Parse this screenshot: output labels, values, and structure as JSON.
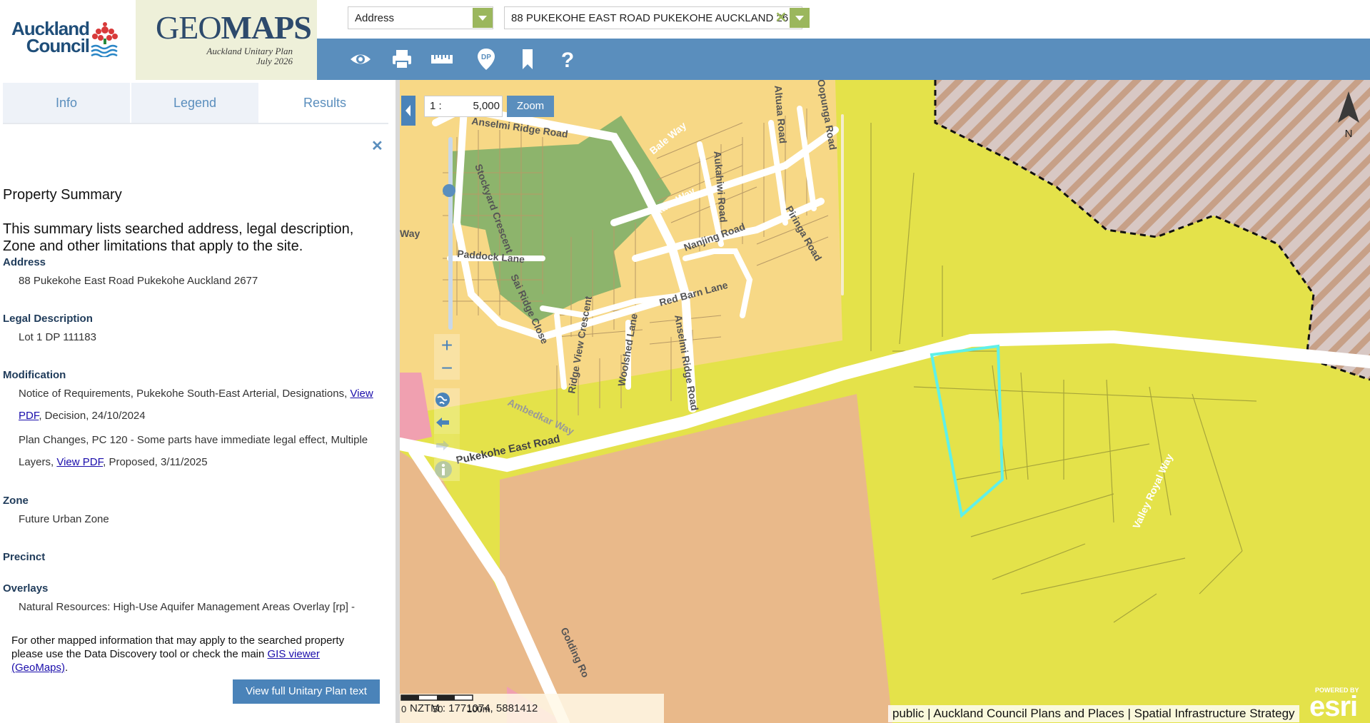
{
  "header": {
    "logo_line1": "Auckland",
    "logo_line2": "Council",
    "app_title_light": "GEO",
    "app_title_bold": "MAPS",
    "app_subtitle_1": "Auckland Unitary Plan",
    "app_subtitle_2": "July 2026"
  },
  "search": {
    "type_value": "Address",
    "query_value": "88 PUKEKOHE EAST ROAD PUKEKOHE AUCKLAND 26",
    "clear_glyph": "✕"
  },
  "toolbar": {
    "icons": [
      "eye-icon",
      "print-icon",
      "ruler-icon",
      "dp-pin-icon",
      "bookmark-icon",
      "help-icon"
    ],
    "dp_label": "DP",
    "help_glyph": "?"
  },
  "panel": {
    "tabs": [
      "Info",
      "Legend",
      "Results"
    ],
    "active_tab": "Results",
    "close_glyph": "✕",
    "summary_title": "Property Summary",
    "summary_desc": "This summary lists searched address, legal description, Zone and other limitations that apply to the site.",
    "address_h": "Address",
    "address_v": "88 Pukekohe East Road Pukekohe Auckland 2677",
    "legal_h": "Legal Description",
    "legal_v": "Lot 1 DP 111183",
    "mod_h": "Modification",
    "mod1_pre": "Notice of Requirements, Pukekohe South-East Arterial, Designations, ",
    "mod1_link": "View PDF",
    "mod1_post": ", Decision, 24/10/2024",
    "mod2_pre": "Plan Changes, PC 120 - Some parts have immediate legal effect, Multiple Layers, ",
    "mod2_link": "View PDF",
    "mod2_post": ", Proposed, 3/11/2025",
    "zone_h": "Zone",
    "zone_v": "Future Urban Zone",
    "precinct_h": "Precinct",
    "overlays_h": "Overlays",
    "overlays_v": "Natural Resources: High-Use Aquifer Management Areas Overlay [rp] -",
    "footer_pre": "For other mapped information that may apply to the searched property please use the Data Discovery tool or check the main ",
    "footer_link": "GIS viewer (GeoMaps)",
    "footer_post": ".",
    "view_plan_button": "View full Unitary Plan text"
  },
  "map": {
    "scale_prefix": "1 :",
    "scale_value": "5,000",
    "zoom_button": "Zoom",
    "zoom_in_glyph": "+",
    "zoom_out_glyph": "−",
    "north_label": "N",
    "coords_text": "NZTM : 1771074, 5881412",
    "scalebar_labels": [
      "0",
      "50",
      "100m"
    ],
    "attribution": "public | Auckland Council Plans and Places | Spatial Infrastructure Strategy",
    "esri_small": "POWERED BY",
    "esri_big": "esri",
    "street_labels": [
      "Anselmi Ridge Road",
      "Bale Way",
      "Stockyard Crescent",
      "Kato Way",
      "Nanjing Road",
      "Paddock Lane",
      "Sai Ridge Close",
      "Red Barn Lane",
      "Ridge View Crescent",
      "Woolshed Lane",
      "Anselmi Ridge Road",
      "Ambedkar Way",
      "Pukekohe East Road",
      "Altuaa Road",
      "Oopunga Road",
      "Aukahiwi Road",
      "Piringa Road",
      "Valley Royal Way",
      "Golding Ro",
      "Way"
    ],
    "colors": {
      "future_urban": "#e4e24a",
      "residential": "#f7d886",
      "large_lot": "#e9b98a",
      "open_space": "#8db46c",
      "selected_parcel": "#5ff0e8",
      "hatch": "#c7a087"
    }
  }
}
